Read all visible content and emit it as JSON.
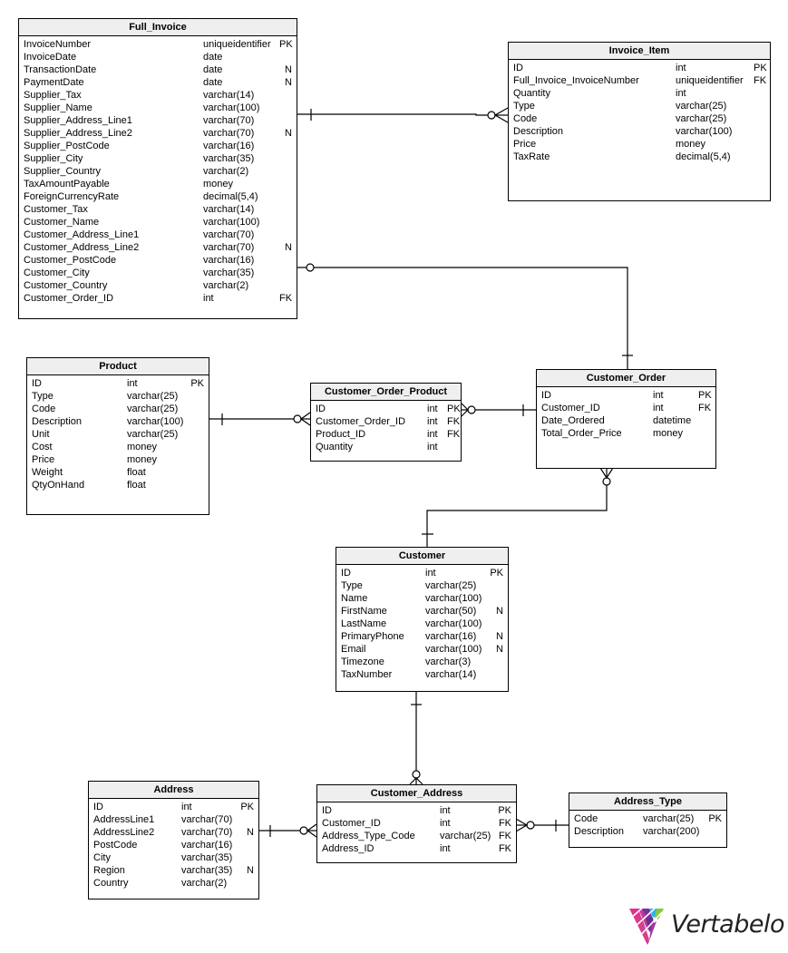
{
  "tables": {
    "full_invoice": {
      "title": "Full_Invoice",
      "columns": [
        {
          "name": "InvoiceNumber",
          "type": "uniqueidentifier",
          "key": "PK"
        },
        {
          "name": "InvoiceDate",
          "type": "date",
          "key": ""
        },
        {
          "name": "TransactionDate",
          "type": "date",
          "key": "N"
        },
        {
          "name": "PaymentDate",
          "type": "date",
          "key": "N"
        },
        {
          "name": "Supplier_Tax",
          "type": "varchar(14)",
          "key": ""
        },
        {
          "name": "Supplier_Name",
          "type": "varchar(100)",
          "key": ""
        },
        {
          "name": "Supplier_Address_Line1",
          "type": "varchar(70)",
          "key": ""
        },
        {
          "name": "Supplier_Address_Line2",
          "type": "varchar(70)",
          "key": "N"
        },
        {
          "name": "Supplier_PostCode",
          "type": "varchar(16)",
          "key": ""
        },
        {
          "name": "Supplier_City",
          "type": "varchar(35)",
          "key": ""
        },
        {
          "name": "Supplier_Country",
          "type": "varchar(2)",
          "key": ""
        },
        {
          "name": "TaxAmountPayable",
          "type": "money",
          "key": ""
        },
        {
          "name": "ForeignCurrencyRate",
          "type": "decimal(5,4)",
          "key": ""
        },
        {
          "name": "Customer_Tax",
          "type": "varchar(14)",
          "key": ""
        },
        {
          "name": "Customer_Name",
          "type": "varchar(100)",
          "key": ""
        },
        {
          "name": "Customer_Address_Line1",
          "type": "varchar(70)",
          "key": ""
        },
        {
          "name": "Customer_Address_Line2",
          "type": "varchar(70)",
          "key": "N"
        },
        {
          "name": "Customer_PostCode",
          "type": "varchar(16)",
          "key": ""
        },
        {
          "name": "Customer_City",
          "type": "varchar(35)",
          "key": ""
        },
        {
          "name": "Customer_Country",
          "type": "varchar(2)",
          "key": ""
        },
        {
          "name": "Customer_Order_ID",
          "type": "int",
          "key": "FK"
        }
      ]
    },
    "invoice_item": {
      "title": "Invoice_Item",
      "columns": [
        {
          "name": "ID",
          "type": "int",
          "key": "PK"
        },
        {
          "name": "Full_Invoice_InvoiceNumber",
          "type": "uniqueidentifier",
          "key": "FK"
        },
        {
          "name": "Quantity",
          "type": "int",
          "key": ""
        },
        {
          "name": "Type",
          "type": "varchar(25)",
          "key": ""
        },
        {
          "name": "Code",
          "type": "varchar(25)",
          "key": ""
        },
        {
          "name": "Description",
          "type": "varchar(100)",
          "key": ""
        },
        {
          "name": "Price",
          "type": "money",
          "key": ""
        },
        {
          "name": "TaxRate",
          "type": "decimal(5,4)",
          "key": ""
        }
      ]
    },
    "product": {
      "title": "Product",
      "columns": [
        {
          "name": "ID",
          "type": "int",
          "key": "PK"
        },
        {
          "name": "Type",
          "type": "varchar(25)",
          "key": ""
        },
        {
          "name": "Code",
          "type": "varchar(25)",
          "key": ""
        },
        {
          "name": "Description",
          "type": "varchar(100)",
          "key": ""
        },
        {
          "name": "Unit",
          "type": "varchar(25)",
          "key": ""
        },
        {
          "name": "Cost",
          "type": "money",
          "key": ""
        },
        {
          "name": "Price",
          "type": "money",
          "key": ""
        },
        {
          "name": "Weight",
          "type": "float",
          "key": ""
        },
        {
          "name": "QtyOnHand",
          "type": "float",
          "key": ""
        }
      ]
    },
    "customer_order_product": {
      "title": "Customer_Order_Product",
      "columns": [
        {
          "name": "ID",
          "type": "int",
          "key": "PK"
        },
        {
          "name": "Customer_Order_ID",
          "type": "int",
          "key": "FK"
        },
        {
          "name": "Product_ID",
          "type": "int",
          "key": "FK"
        },
        {
          "name": "Quantity",
          "type": "int",
          "key": ""
        }
      ]
    },
    "customer_order": {
      "title": "Customer_Order",
      "columns": [
        {
          "name": "ID",
          "type": "int",
          "key": "PK"
        },
        {
          "name": "Customer_ID",
          "type": "int",
          "key": "FK"
        },
        {
          "name": "Date_Ordered",
          "type": "datetime",
          "key": ""
        },
        {
          "name": "Total_Order_Price",
          "type": "money",
          "key": ""
        }
      ]
    },
    "customer": {
      "title": "Customer",
      "columns": [
        {
          "name": "ID",
          "type": "int",
          "key": "PK"
        },
        {
          "name": "Type",
          "type": "varchar(25)",
          "key": ""
        },
        {
          "name": "Name",
          "type": "varchar(100)",
          "key": ""
        },
        {
          "name": "FirstName",
          "type": "varchar(50)",
          "key": "N"
        },
        {
          "name": "LastName",
          "type": "varchar(100)",
          "key": ""
        },
        {
          "name": "PrimaryPhone",
          "type": "varchar(16)",
          "key": "N"
        },
        {
          "name": "Email",
          "type": "varchar(100)",
          "key": "N"
        },
        {
          "name": "Timezone",
          "type": "varchar(3)",
          "key": ""
        },
        {
          "name": "TaxNumber",
          "type": "varchar(14)",
          "key": ""
        }
      ]
    },
    "address": {
      "title": "Address",
      "columns": [
        {
          "name": "ID",
          "type": "int",
          "key": "PK"
        },
        {
          "name": "AddressLine1",
          "type": "varchar(70)",
          "key": ""
        },
        {
          "name": "AddressLine2",
          "type": "varchar(70)",
          "key": "N"
        },
        {
          "name": "PostCode",
          "type": "varchar(16)",
          "key": ""
        },
        {
          "name": "City",
          "type": "varchar(35)",
          "key": ""
        },
        {
          "name": "Region",
          "type": "varchar(35)",
          "key": "N"
        },
        {
          "name": "Country",
          "type": "varchar(2)",
          "key": ""
        }
      ]
    },
    "customer_address": {
      "title": "Customer_Address",
      "columns": [
        {
          "name": "ID",
          "type": "int",
          "key": "PK"
        },
        {
          "name": "Customer_ID",
          "type": "int",
          "key": "FK"
        },
        {
          "name": "Address_Type_Code",
          "type": "varchar(25)",
          "key": "FK"
        },
        {
          "name": "Address_ID",
          "type": "int",
          "key": "FK"
        }
      ]
    },
    "address_type": {
      "title": "Address_Type",
      "columns": [
        {
          "name": "Code",
          "type": "varchar(25)",
          "key": "PK"
        },
        {
          "name": "Description",
          "type": "varchar(200)",
          "key": ""
        }
      ]
    }
  },
  "relationships": [
    {
      "from": "Full_Invoice",
      "to": "Invoice_Item",
      "from_cardinality": "one",
      "to_cardinality": "zero-or-many"
    },
    {
      "from": "Customer_Order",
      "to": "Full_Invoice",
      "from_cardinality": "one",
      "to_cardinality": "zero-or-one"
    },
    {
      "from": "Product",
      "to": "Customer_Order_Product",
      "from_cardinality": "one",
      "to_cardinality": "zero-or-many"
    },
    {
      "from": "Customer_Order",
      "to": "Customer_Order_Product",
      "from_cardinality": "one",
      "to_cardinality": "zero-or-many"
    },
    {
      "from": "Customer",
      "to": "Customer_Order",
      "from_cardinality": "one",
      "to_cardinality": "zero-or-many"
    },
    {
      "from": "Customer",
      "to": "Customer_Address",
      "from_cardinality": "one",
      "to_cardinality": "zero-or-many"
    },
    {
      "from": "Address",
      "to": "Customer_Address",
      "from_cardinality": "one",
      "to_cardinality": "zero-or-many"
    },
    {
      "from": "Address_Type",
      "to": "Customer_Address",
      "from_cardinality": "one",
      "to_cardinality": "zero-or-many"
    }
  ],
  "branding": {
    "logo_text": "Vertabelo",
    "logo_colors": [
      "#e0338f",
      "#7b2f9e",
      "#29b5e8",
      "#8cc63f"
    ]
  }
}
